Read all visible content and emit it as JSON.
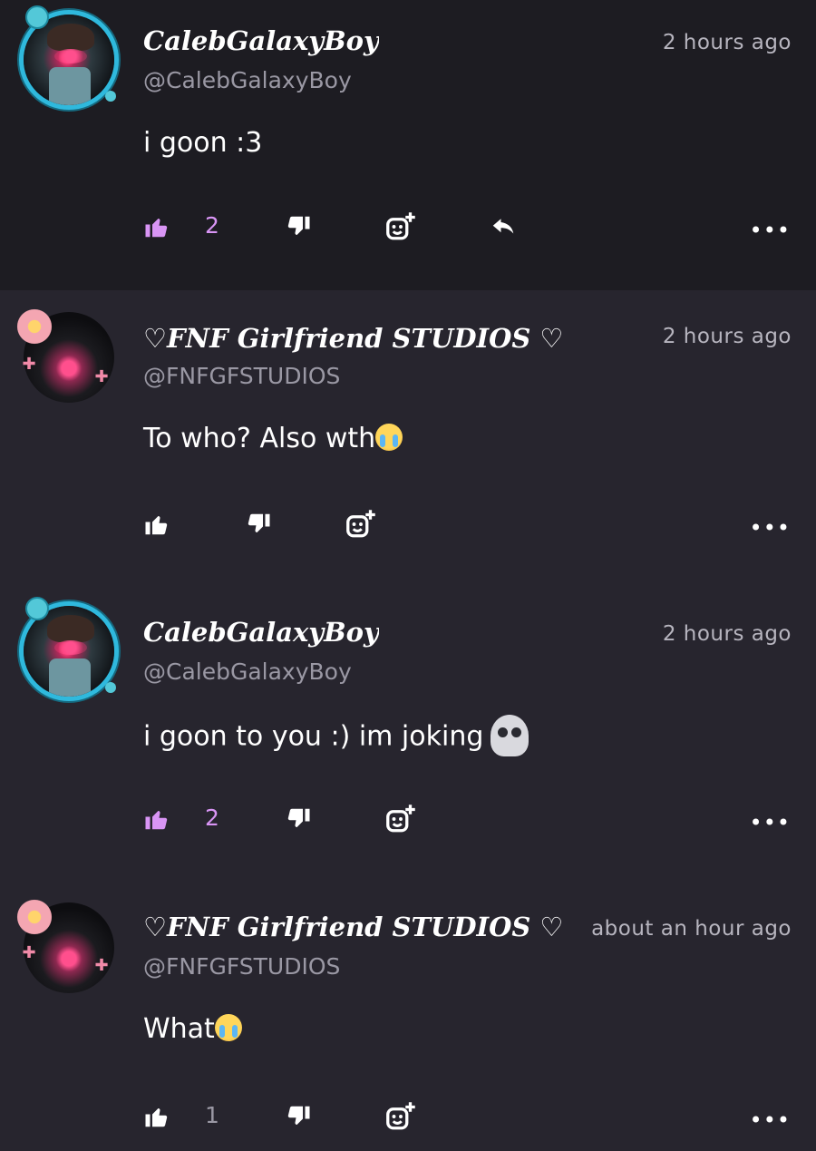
{
  "comments": [
    {
      "name": "CalebGalaxyBoy",
      "handle": "@CalebGalaxyBoy",
      "time": "2 hours ago",
      "text": "i goon :3",
      "emoji": "",
      "likes": "2",
      "liked": true,
      "has_reply": true
    },
    {
      "name": "♡FNF Girlfriend STUDIOS ♡",
      "handle": "@FNFGFSTUDIOS",
      "time": "2 hours ago",
      "text": "To who? Also wth",
      "emoji": "loudly-crying-face",
      "likes": "",
      "liked": false,
      "has_reply": false
    },
    {
      "name": "CalebGalaxyBoy",
      "handle": "@CalebGalaxyBoy",
      "time": "2 hours ago",
      "text": "i goon to you :) im joking",
      "emoji": "skull",
      "likes": "2",
      "liked": true,
      "has_reply": false
    },
    {
      "name": "♡FNF Girlfriend STUDIOS ♡",
      "handle": "@FNFGFSTUDIOS",
      "time": "about an hour ago",
      "text": "What",
      "emoji": "loudly-crying-face",
      "likes": "1",
      "liked": false,
      "has_reply": false
    }
  ],
  "more_label": "•••",
  "colors": {
    "liked_accent": "#d995f5",
    "neutral_count": "#9a98a4",
    "background": "#27252e",
    "highlight_background": "#1d1c22"
  }
}
